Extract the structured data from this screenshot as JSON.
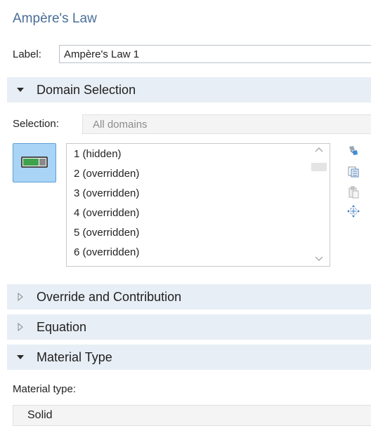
{
  "header": {
    "title": "Ampère's Law"
  },
  "label_field": {
    "label": "Label:",
    "value": "Ampère's Law 1"
  },
  "sections": {
    "domain_selection": "Domain Selection",
    "override_contribution": "Override and Contribution",
    "equation": "Equation",
    "material_type": "Material Type"
  },
  "selection": {
    "label": "Selection:",
    "value": "All domains"
  },
  "domain_list": {
    "items": [
      "1 (hidden)",
      "2 (overridden)",
      "3 (overridden)",
      "4 (overridden)",
      "5 (overridden)",
      "6 (overridden)"
    ]
  },
  "side_icons": [
    "paint-icon",
    "list-icon",
    "paste-icon",
    "zoom-to-selection-icon"
  ],
  "material": {
    "label": "Material type:",
    "value": "Solid"
  },
  "colors": {
    "title": "#4a6e97",
    "section_bg": "#e8eef5",
    "toggle_bg": "#a9d4f6",
    "toggle_border": "#5a9fd8",
    "toggle_green": "#3fa34d"
  }
}
